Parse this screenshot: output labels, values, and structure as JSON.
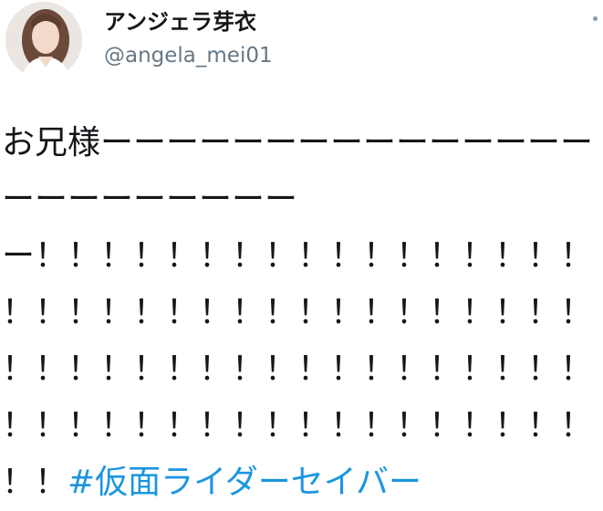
{
  "user": {
    "display_name": "アンジェラ芽衣",
    "username": "@angela_mei01",
    "avatar_icon": "profile-photo"
  },
  "tweet": {
    "text": "お兄様ーーーーーーーーーーーーーーーーーーーーーーーーー！！！！！！！！！！！！！！！！！！！！！！！！！！！！！！！！！！！！！！！！！！！！！！！！！！！！！！！！！！！！！！！！！！！！！！！！！",
    "hashtag": "#仮面ライダーセイバー"
  },
  "colors": {
    "text": "#14171a",
    "secondary": "#657786",
    "link": "#1b95e0"
  },
  "menu": {
    "icon": "more-icon"
  }
}
